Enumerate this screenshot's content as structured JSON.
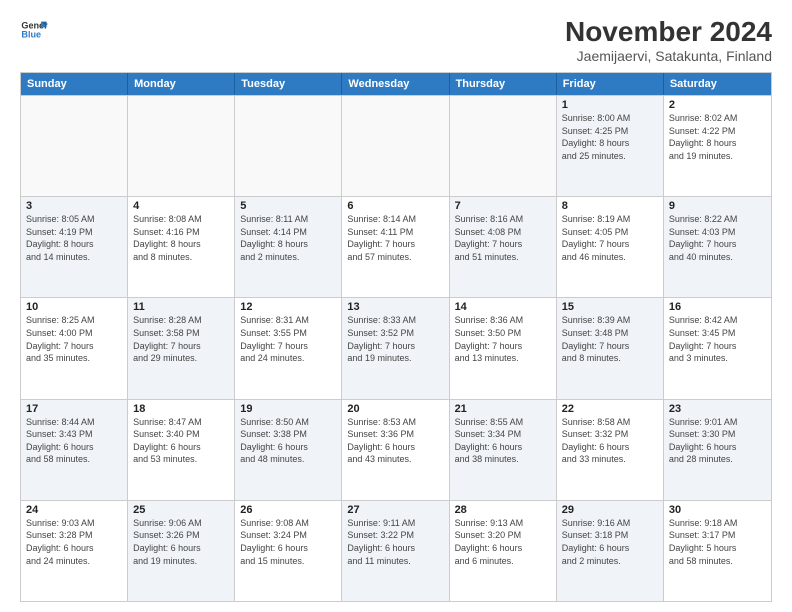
{
  "header": {
    "title": "November 2024",
    "subtitle": "Jaemijaervi, Satakunta, Finland",
    "logo_line1": "General",
    "logo_line2": "Blue"
  },
  "weekdays": [
    "Sunday",
    "Monday",
    "Tuesday",
    "Wednesday",
    "Thursday",
    "Friday",
    "Saturday"
  ],
  "rows": [
    {
      "cells": [
        {
          "empty": true
        },
        {
          "empty": true
        },
        {
          "empty": true
        },
        {
          "empty": true
        },
        {
          "empty": true
        },
        {
          "day": 1,
          "shaded": true,
          "info": "Sunrise: 8:00 AM\nSunset: 4:25 PM\nDaylight: 8 hours\nand 25 minutes."
        },
        {
          "day": 2,
          "info": "Sunrise: 8:02 AM\nSunset: 4:22 PM\nDaylight: 8 hours\nand 19 minutes."
        }
      ]
    },
    {
      "cells": [
        {
          "day": 3,
          "shaded": true,
          "info": "Sunrise: 8:05 AM\nSunset: 4:19 PM\nDaylight: 8 hours\nand 14 minutes."
        },
        {
          "day": 4,
          "info": "Sunrise: 8:08 AM\nSunset: 4:16 PM\nDaylight: 8 hours\nand 8 minutes."
        },
        {
          "day": 5,
          "shaded": true,
          "info": "Sunrise: 8:11 AM\nSunset: 4:14 PM\nDaylight: 8 hours\nand 2 minutes."
        },
        {
          "day": 6,
          "info": "Sunrise: 8:14 AM\nSunset: 4:11 PM\nDaylight: 7 hours\nand 57 minutes."
        },
        {
          "day": 7,
          "shaded": true,
          "info": "Sunrise: 8:16 AM\nSunset: 4:08 PM\nDaylight: 7 hours\nand 51 minutes."
        },
        {
          "day": 8,
          "info": "Sunrise: 8:19 AM\nSunset: 4:05 PM\nDaylight: 7 hours\nand 46 minutes."
        },
        {
          "day": 9,
          "shaded": true,
          "info": "Sunrise: 8:22 AM\nSunset: 4:03 PM\nDaylight: 7 hours\nand 40 minutes."
        }
      ]
    },
    {
      "cells": [
        {
          "day": 10,
          "info": "Sunrise: 8:25 AM\nSunset: 4:00 PM\nDaylight: 7 hours\nand 35 minutes."
        },
        {
          "day": 11,
          "shaded": true,
          "info": "Sunrise: 8:28 AM\nSunset: 3:58 PM\nDaylight: 7 hours\nand 29 minutes."
        },
        {
          "day": 12,
          "info": "Sunrise: 8:31 AM\nSunset: 3:55 PM\nDaylight: 7 hours\nand 24 minutes."
        },
        {
          "day": 13,
          "shaded": true,
          "info": "Sunrise: 8:33 AM\nSunset: 3:52 PM\nDaylight: 7 hours\nand 19 minutes."
        },
        {
          "day": 14,
          "info": "Sunrise: 8:36 AM\nSunset: 3:50 PM\nDaylight: 7 hours\nand 13 minutes."
        },
        {
          "day": 15,
          "shaded": true,
          "info": "Sunrise: 8:39 AM\nSunset: 3:48 PM\nDaylight: 7 hours\nand 8 minutes."
        },
        {
          "day": 16,
          "info": "Sunrise: 8:42 AM\nSunset: 3:45 PM\nDaylight: 7 hours\nand 3 minutes."
        }
      ]
    },
    {
      "cells": [
        {
          "day": 17,
          "shaded": true,
          "info": "Sunrise: 8:44 AM\nSunset: 3:43 PM\nDaylight: 6 hours\nand 58 minutes."
        },
        {
          "day": 18,
          "info": "Sunrise: 8:47 AM\nSunset: 3:40 PM\nDaylight: 6 hours\nand 53 minutes."
        },
        {
          "day": 19,
          "shaded": true,
          "info": "Sunrise: 8:50 AM\nSunset: 3:38 PM\nDaylight: 6 hours\nand 48 minutes."
        },
        {
          "day": 20,
          "info": "Sunrise: 8:53 AM\nSunset: 3:36 PM\nDaylight: 6 hours\nand 43 minutes."
        },
        {
          "day": 21,
          "shaded": true,
          "info": "Sunrise: 8:55 AM\nSunset: 3:34 PM\nDaylight: 6 hours\nand 38 minutes."
        },
        {
          "day": 22,
          "info": "Sunrise: 8:58 AM\nSunset: 3:32 PM\nDaylight: 6 hours\nand 33 minutes."
        },
        {
          "day": 23,
          "shaded": true,
          "info": "Sunrise: 9:01 AM\nSunset: 3:30 PM\nDaylight: 6 hours\nand 28 minutes."
        }
      ]
    },
    {
      "cells": [
        {
          "day": 24,
          "info": "Sunrise: 9:03 AM\nSunset: 3:28 PM\nDaylight: 6 hours\nand 24 minutes."
        },
        {
          "day": 25,
          "shaded": true,
          "info": "Sunrise: 9:06 AM\nSunset: 3:26 PM\nDaylight: 6 hours\nand 19 minutes."
        },
        {
          "day": 26,
          "info": "Sunrise: 9:08 AM\nSunset: 3:24 PM\nDaylight: 6 hours\nand 15 minutes."
        },
        {
          "day": 27,
          "shaded": true,
          "info": "Sunrise: 9:11 AM\nSunset: 3:22 PM\nDaylight: 6 hours\nand 11 minutes."
        },
        {
          "day": 28,
          "info": "Sunrise: 9:13 AM\nSunset: 3:20 PM\nDaylight: 6 hours\nand 6 minutes."
        },
        {
          "day": 29,
          "shaded": true,
          "info": "Sunrise: 9:16 AM\nSunset: 3:18 PM\nDaylight: 6 hours\nand 2 minutes."
        },
        {
          "day": 30,
          "info": "Sunrise: 9:18 AM\nSunset: 3:17 PM\nDaylight: 5 hours\nand 58 minutes."
        }
      ]
    }
  ]
}
